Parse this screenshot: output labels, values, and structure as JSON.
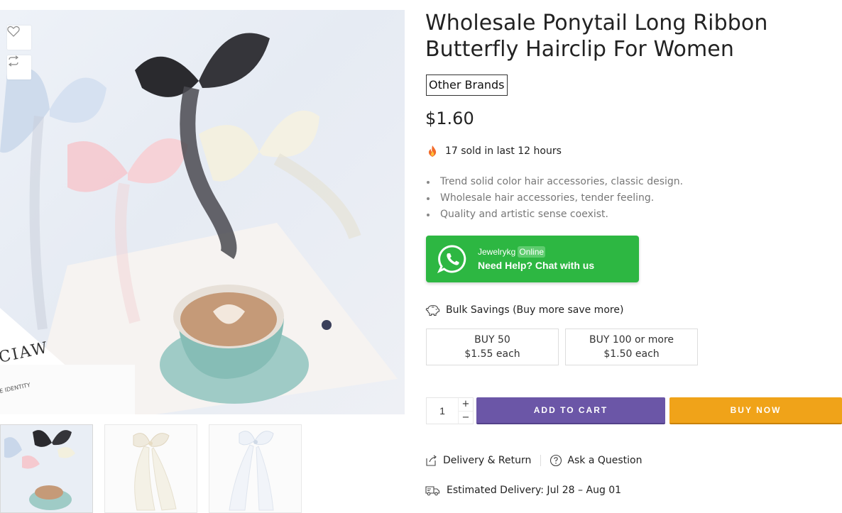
{
  "product": {
    "title": "Wholesale Ponytail Long Ribbon Butterfly Hairclip For Women",
    "brand": "Other Brands",
    "price": "$1.60",
    "sold_text": "17 sold in last 12 hours",
    "features": [
      "Trend solid color hair accessories, classic design.",
      "Wholesale hair accessories, tender feeling.",
      "Quality and artistic sense coexist."
    ]
  },
  "image": {
    "watermark": "CIAW",
    "watermark_sub": "E IDENTITY"
  },
  "gallery": {
    "thumbnail_count": 3,
    "icons": [
      "heart-icon",
      "compare-icon"
    ]
  },
  "whatsapp": {
    "agent": "Jewelrykg",
    "status": "Online",
    "cta": "Need Help? Chat with us",
    "color": "#2db742"
  },
  "bulk": {
    "title": "Bulk Savings (Buy more save more)",
    "tiers": [
      {
        "qty": "BUY 50",
        "price": "$1.55 each"
      },
      {
        "qty": "BUY 100 or more",
        "price": "$1.50 each"
      }
    ]
  },
  "cart": {
    "quantity": "1",
    "plus": "+",
    "minus": "−",
    "add_to_cart": "ADD TO CART",
    "buy_now": "BUY NOW",
    "add_color": "#6b56a7",
    "buy_color": "#f0a319"
  },
  "links": {
    "delivery_return": "Delivery & Return",
    "ask_question": "Ask a Question",
    "estimated_delivery": "Estimated Delivery: Jul 28 – Aug 01"
  }
}
